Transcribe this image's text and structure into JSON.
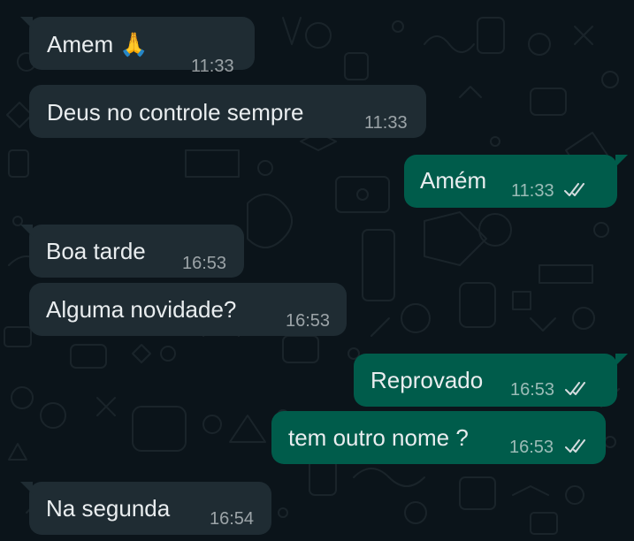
{
  "messages": [
    {
      "text": "Amem 🙏",
      "time": "11:33",
      "direction": "incoming"
    },
    {
      "text": "Deus no controle sempre",
      "time": "11:33",
      "direction": "incoming"
    },
    {
      "text": "Amém",
      "time": "11:33",
      "direction": "outgoing",
      "status": "read-double-check"
    },
    {
      "text": "Boa tarde",
      "time": "16:53",
      "direction": "incoming"
    },
    {
      "text": "Alguma novidade?",
      "time": "16:53",
      "direction": "incoming"
    },
    {
      "text": "Reprovado",
      "time": "16:53",
      "direction": "outgoing",
      "status": "read-double-check"
    },
    {
      "text": "tem outro nome ?",
      "time": "16:53",
      "direction": "outgoing",
      "status": "read-double-check"
    },
    {
      "text": "Na segunda",
      "time": "16:54",
      "direction": "incoming"
    }
  ],
  "colors": {
    "background": "#0b141a",
    "incoming_bubble": "#1f2c33",
    "outgoing_bubble": "#005c4b",
    "text": "#e9edef"
  },
  "icons": {
    "read_receipt": "double-check-icon"
  }
}
